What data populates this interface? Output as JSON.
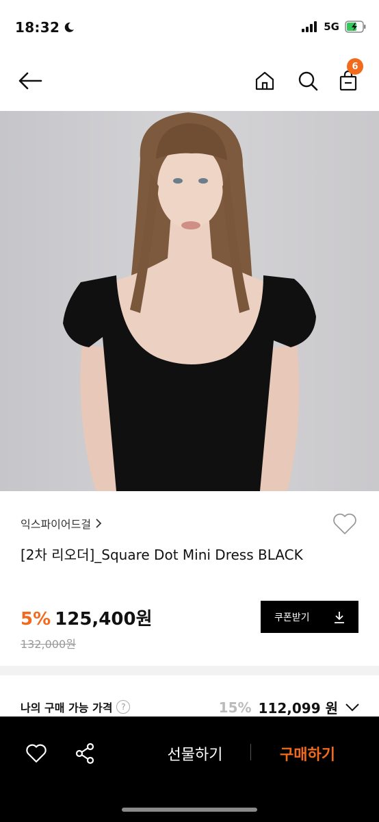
{
  "status_bar": {
    "time": "18:32",
    "network": "5G"
  },
  "nav": {
    "cart_count": "6"
  },
  "product": {
    "brand": "익스파이어드걸",
    "title": "[2차 리오더]_Square Dot Mini Dress BLACK",
    "discount": "5%",
    "price": "125,400원",
    "original_price": "132,000원",
    "coupon_label": "쿠폰받기"
  },
  "my_price": {
    "label": "나의 구매 가능 가격",
    "help": "?",
    "discount": "15%",
    "price": "112,099 원"
  },
  "bottom_bar": {
    "gift_label": "선물하기",
    "buy_label": "구매하기"
  },
  "colors": {
    "accent": "#f26b1d",
    "bar": "#000000"
  }
}
